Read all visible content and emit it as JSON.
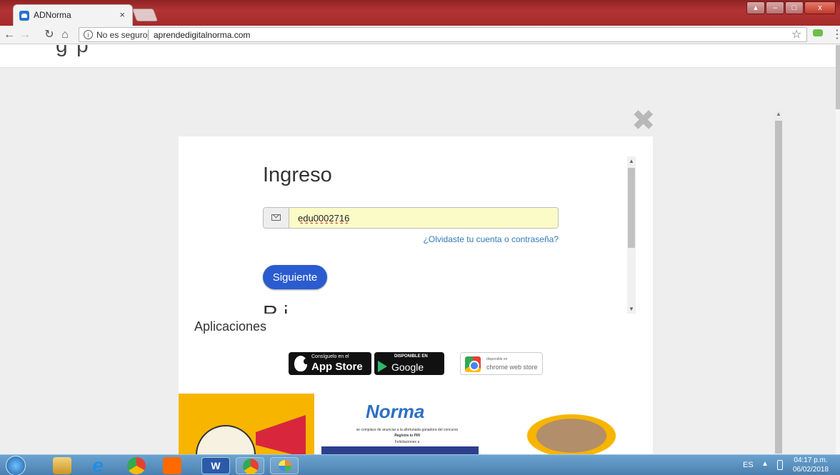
{
  "browser": {
    "tab_title": "ADNorma",
    "tab_close": "×",
    "security_label": "No es seguro",
    "url": "aprendedigitalnorma.com",
    "icons": [
      "back-arrow-icon",
      "forward-arrow-icon",
      "reload-icon",
      "home-icon",
      "info-icon",
      "star-icon",
      "extension-icon",
      "menu-icon"
    ]
  },
  "page": {
    "header_fragment": "g    p",
    "overlay_close": "✖"
  },
  "login": {
    "title": "Ingreso",
    "email_value": "edu0002716",
    "forgot_link": "¿Olvidaste tu cuenta o contraseña?",
    "next_button": "Siguiente",
    "cutoff_title": "R      i",
    "accent_color": "#2a5ccf"
  },
  "apps": {
    "title": "Aplicaciones",
    "app_store": {
      "small": "Consíguelo en el",
      "big": "App Store"
    },
    "google_play": {
      "small": "DISPONIBLE EN",
      "big": "Google play"
    },
    "chrome_store": {
      "small": "disponible en",
      "big": "chrome web store"
    }
  },
  "promo": {
    "logo": "Norma",
    "line1": "se complace de anunciar a la afortunada ganadora del concurso",
    "line2": "Registra tu PIN",
    "line3": "Felicitaciones a"
  },
  "taskbar": {
    "language": "ES",
    "time": "04:17 p.m.",
    "date": "06/02/2018",
    "word_label": "W"
  }
}
